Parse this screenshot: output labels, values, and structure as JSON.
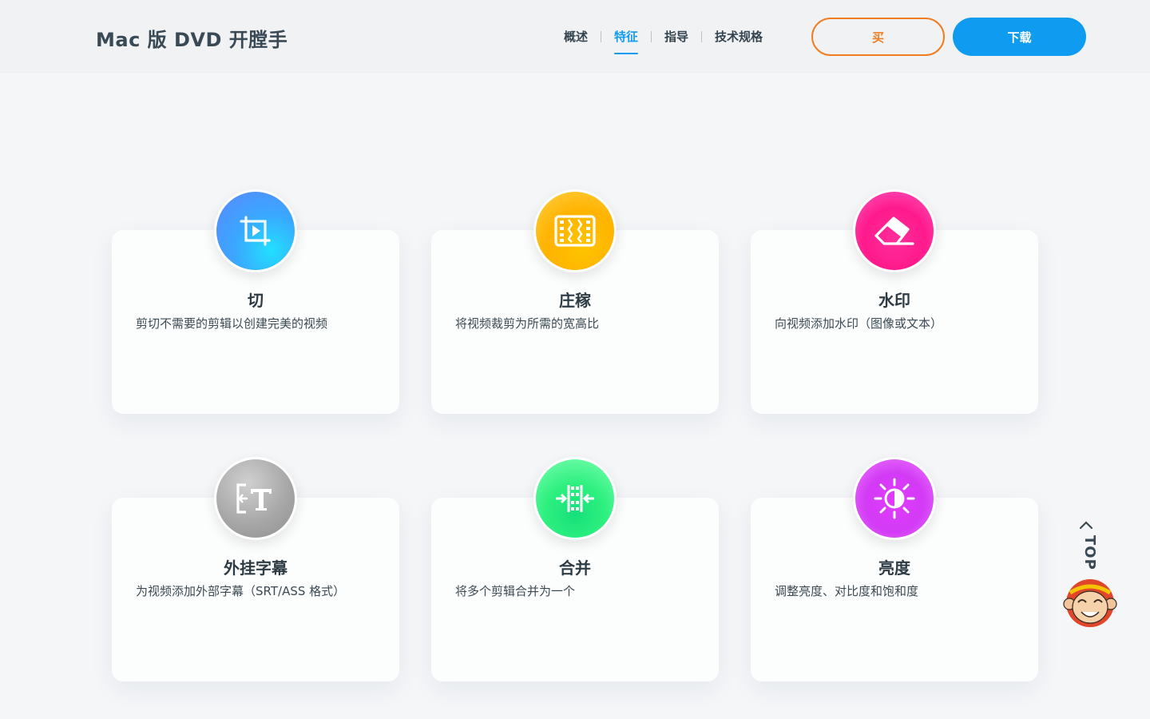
{
  "header": {
    "brand": "Mac 版 DVD 开膛手",
    "nav": [
      {
        "label": "概述",
        "active": false
      },
      {
        "label": "特征",
        "active": true
      },
      {
        "label": "指导",
        "active": false
      },
      {
        "label": "技术规格",
        "active": false
      }
    ],
    "buy_label": "买",
    "download_label": "下载"
  },
  "features": [
    {
      "title": "切",
      "desc": "剪切不需要的剪辑以创建完美的视频",
      "icon": "crop-play-icon",
      "color": "#3aa8ff"
    },
    {
      "title": "庄稼",
      "desc": "将视频裁剪为所需的宽高比",
      "icon": "film-crop-icon",
      "color": "#ffb300"
    },
    {
      "title": "水印",
      "desc": "向视频添加水印（图像或文本）",
      "icon": "eraser-icon",
      "color": "#ff1a8c"
    },
    {
      "title": "外挂字幕",
      "desc": "为视频添加外部字幕（SRT/ASS 格式）",
      "icon": "subtitle-icon",
      "color": "#a8a8a8"
    },
    {
      "title": "合并",
      "desc": "将多个剪辑合并为一个",
      "icon": "merge-icon",
      "color": "#2ef07f"
    },
    {
      "title": "亮度",
      "desc": "调整亮度、对比度和饱和度",
      "icon": "brightness-icon",
      "color": "#d23bf5"
    }
  ],
  "back_to_top": {
    "label": "TOP",
    "icon": "monkey-mascot-icon"
  },
  "colors": {
    "accent_blue": "#0f9cf0",
    "accent_orange": "#f07d22",
    "page_bg": "#f4f6f8"
  }
}
